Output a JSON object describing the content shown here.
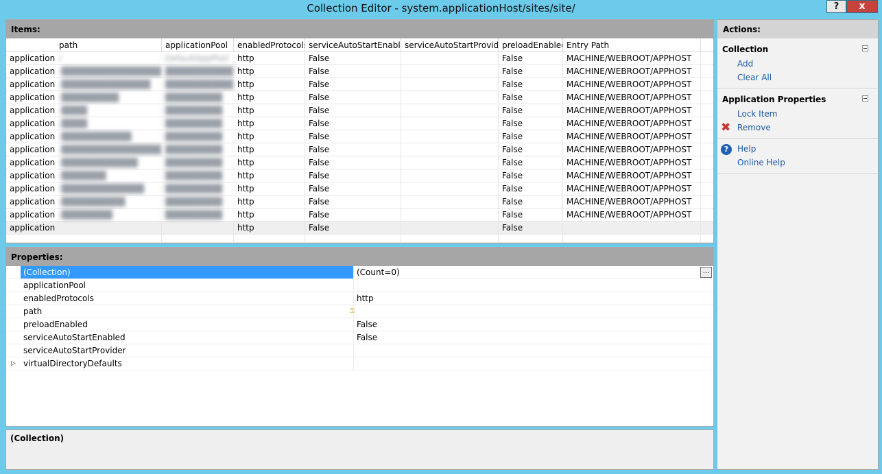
{
  "window": {
    "title": "Collection Editor - system.applicationHost/sites/site/",
    "help_label": "?",
    "close_label": "x"
  },
  "items": {
    "header": "Items:",
    "columns": [
      "",
      "path",
      "applicationPool",
      "enabledProtocols",
      "serviceAutoStartEnabled",
      "serviceAutoStartProvider",
      "preloadEnabled",
      "Entry Path"
    ],
    "rows": [
      {
        "type": "application",
        "path": "/",
        "pool": "DefaultAppPool",
        "protocols": "http",
        "autoStart": "False",
        "provider": "",
        "preload": "False",
        "entry": "MACHINE/WEBROOT/APPHOST"
      },
      {
        "type": "application",
        "path": "/████████████████",
        "pool": "████████████████e",
        "protocols": "http",
        "autoStart": "False",
        "provider": "",
        "preload": "False",
        "entry": "MACHINE/WEBROOT/APPHOST"
      },
      {
        "type": "application",
        "path": "/██████████████",
        "pool": "████████████████e",
        "protocols": "http",
        "autoStart": "False",
        "provider": "",
        "preload": "False",
        "entry": "MACHINE/WEBROOT/APPHOST"
      },
      {
        "type": "application",
        "path": "/█████████",
        "pool": "█████████",
        "protocols": "http",
        "autoStart": "False",
        "provider": "",
        "preload": "False",
        "entry": "MACHINE/WEBROOT/APPHOST"
      },
      {
        "type": "application",
        "path": "/████",
        "pool": "█████████",
        "protocols": "http",
        "autoStart": "False",
        "provider": "",
        "preload": "False",
        "entry": "MACHINE/WEBROOT/APPHOST"
      },
      {
        "type": "application",
        "path": "/████",
        "pool": "█████████",
        "protocols": "http",
        "autoStart": "False",
        "provider": "",
        "preload": "False",
        "entry": "MACHINE/WEBROOT/APPHOST"
      },
      {
        "type": "application",
        "path": "/███████████",
        "pool": "█████████",
        "protocols": "http",
        "autoStart": "False",
        "provider": "",
        "preload": "False",
        "entry": "MACHINE/WEBROOT/APPHOST"
      },
      {
        "type": "application",
        "path": "/████████████████",
        "pool": "█████████",
        "protocols": "http",
        "autoStart": "False",
        "provider": "",
        "preload": "False",
        "entry": "MACHINE/WEBROOT/APPHOST"
      },
      {
        "type": "application",
        "path": "/████████████",
        "pool": "█████████",
        "protocols": "http",
        "autoStart": "False",
        "provider": "",
        "preload": "False",
        "entry": "MACHINE/WEBROOT/APPHOST"
      },
      {
        "type": "application",
        "path": "/███████",
        "pool": "█████████",
        "protocols": "http",
        "autoStart": "False",
        "provider": "",
        "preload": "False",
        "entry": "MACHINE/WEBROOT/APPHOST"
      },
      {
        "type": "application",
        "path": "/█████████████",
        "pool": "█████████",
        "protocols": "http",
        "autoStart": "False",
        "provider": "",
        "preload": "False",
        "entry": "MACHINE/WEBROOT/APPHOST"
      },
      {
        "type": "application",
        "path": "/██████████",
        "pool": "█████████",
        "protocols": "http",
        "autoStart": "False",
        "provider": "",
        "preload": "False",
        "entry": "MACHINE/WEBROOT/APPHOST"
      },
      {
        "type": "application",
        "path": "/████████",
        "pool": "█████████",
        "protocols": "http",
        "autoStart": "False",
        "provider": "",
        "preload": "False",
        "entry": "MACHINE/WEBROOT/APPHOST"
      },
      {
        "type": "application",
        "path": "",
        "pool": "",
        "protocols": "http",
        "autoStart": "False",
        "provider": "",
        "preload": "False",
        "entry": ""
      }
    ]
  },
  "properties": {
    "header": "Properties:",
    "rows": [
      {
        "name": "(Collection)",
        "value": "(Count=0)",
        "selected": true,
        "expandable": false
      },
      {
        "name": "applicationPool",
        "value": "",
        "selected": false,
        "expandable": false
      },
      {
        "name": "enabledProtocols",
        "value": "http",
        "selected": false,
        "expandable": false
      },
      {
        "name": "path",
        "value": "",
        "selected": false,
        "expandable": false,
        "key": true
      },
      {
        "name": "preloadEnabled",
        "value": "False",
        "selected": false,
        "expandable": false
      },
      {
        "name": "serviceAutoStartEnabled",
        "value": "False",
        "selected": false,
        "expandable": false
      },
      {
        "name": "serviceAutoStartProvider",
        "value": "",
        "selected": false,
        "expandable": false
      },
      {
        "name": "virtualDirectoryDefaults",
        "value": "",
        "selected": false,
        "expandable": true
      }
    ],
    "ellipsis_label": "..."
  },
  "description": {
    "title": "(Collection)"
  },
  "actions": {
    "header": "Actions:",
    "sections": [
      {
        "title": "Collection",
        "items": [
          {
            "label": "Add",
            "icon": ""
          },
          {
            "label": "Clear All",
            "icon": ""
          }
        ]
      },
      {
        "title": "Application Properties",
        "items": [
          {
            "label": "Lock Item",
            "icon": ""
          },
          {
            "label": "Remove",
            "icon": "remove-icon"
          }
        ]
      },
      {
        "title": "",
        "items": [
          {
            "label": "Help",
            "icon": "help-icon"
          },
          {
            "label": "Online Help",
            "icon": ""
          }
        ]
      }
    ]
  }
}
